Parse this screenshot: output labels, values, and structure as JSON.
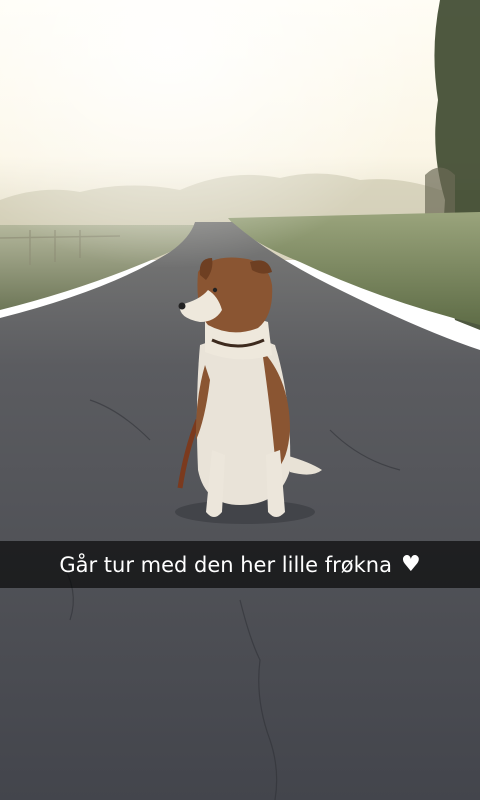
{
  "snap": {
    "caption": "Går tur med den her lille frøkna",
    "caption_emoji": "♥",
    "caption_emoji_name": "white-heart-icon",
    "photo_subject": "dog-sitting-on-road"
  },
  "colors": {
    "caption_bar": "#000000",
    "caption_text": "#ffffff",
    "sky": "#fbf6e6",
    "grass": "#6f7a55",
    "road": "#4a4b52",
    "dog_brown": "#8a5532",
    "dog_white": "#e9e3d8"
  }
}
